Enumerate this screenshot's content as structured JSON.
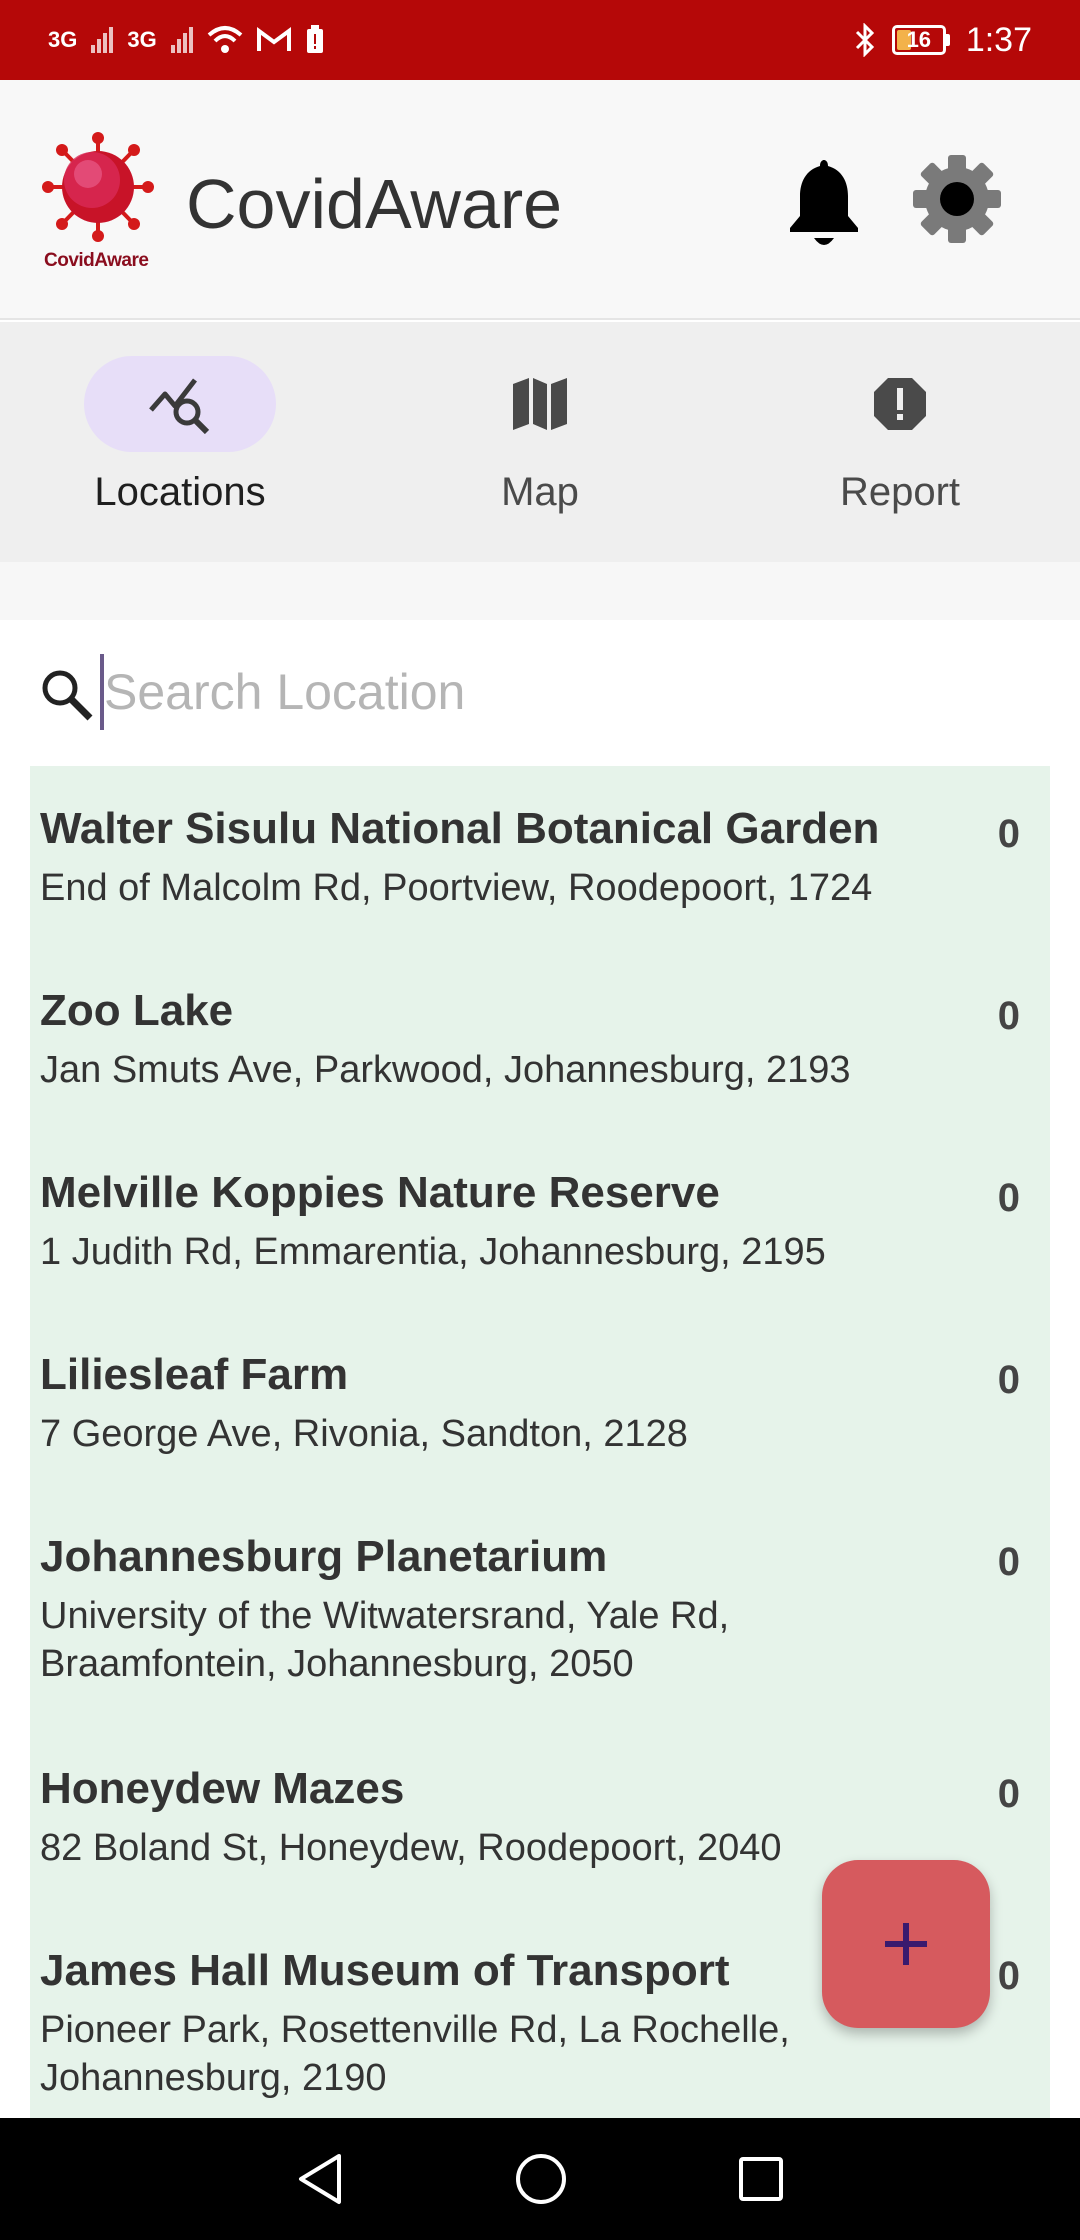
{
  "status_bar": {
    "net1": "3G",
    "net2": "3G",
    "battery": "16",
    "time": "1:37"
  },
  "header": {
    "logo_text": "CovidAware",
    "title": "CovidAware",
    "icons": [
      "bell-icon",
      "gear-icon"
    ]
  },
  "tabs": [
    {
      "label": "Locations",
      "icon": "trending-search-icon",
      "active": true
    },
    {
      "label": "Map",
      "icon": "map-icon",
      "active": false
    },
    {
      "label": "Report",
      "icon": "report-icon",
      "active": false
    }
  ],
  "search": {
    "placeholder": "Search Location",
    "value": ""
  },
  "locations": [
    {
      "name": "Walter Sisulu National Botanical Garden",
      "address": "End of Malcolm Rd, Poortview, Roodepoort, 1724",
      "count": "0"
    },
    {
      "name": "Zoo Lake",
      "address": "Jan Smuts Ave, Parkwood, Johannesburg, 2193",
      "count": "0"
    },
    {
      "name": "Melville Koppies Nature Reserve",
      "address": "1 Judith Rd, Emmarentia, Johannesburg, 2195",
      "count": "0"
    },
    {
      "name": "Liliesleaf Farm",
      "address": "7 George Ave, Rivonia, Sandton, 2128",
      "count": "0"
    },
    {
      "name": "Johannesburg Planetarium",
      "address": "University of the Witwatersrand, Yale Rd, Braamfontein, Johannesburg, 2050",
      "count": "0"
    },
    {
      "name": "Honeydew Mazes",
      "address": "82 Boland St, Honeydew, Roodepoort, 2040",
      "count": "0"
    },
    {
      "name": "James Hall Museum of Transport",
      "address": "Pioneer Park, Rosettenville Rd, La Rochelle, Johannesburg, 2190",
      "count": "0"
    }
  ],
  "fab": {
    "icon": "plus-icon"
  },
  "colors": {
    "status_bar": "#b50808",
    "active_tab_pill": "#e7def8",
    "list_background": "#e6f3ea",
    "fab": "#d65a5e",
    "fab_icon": "#3a1a6e"
  }
}
